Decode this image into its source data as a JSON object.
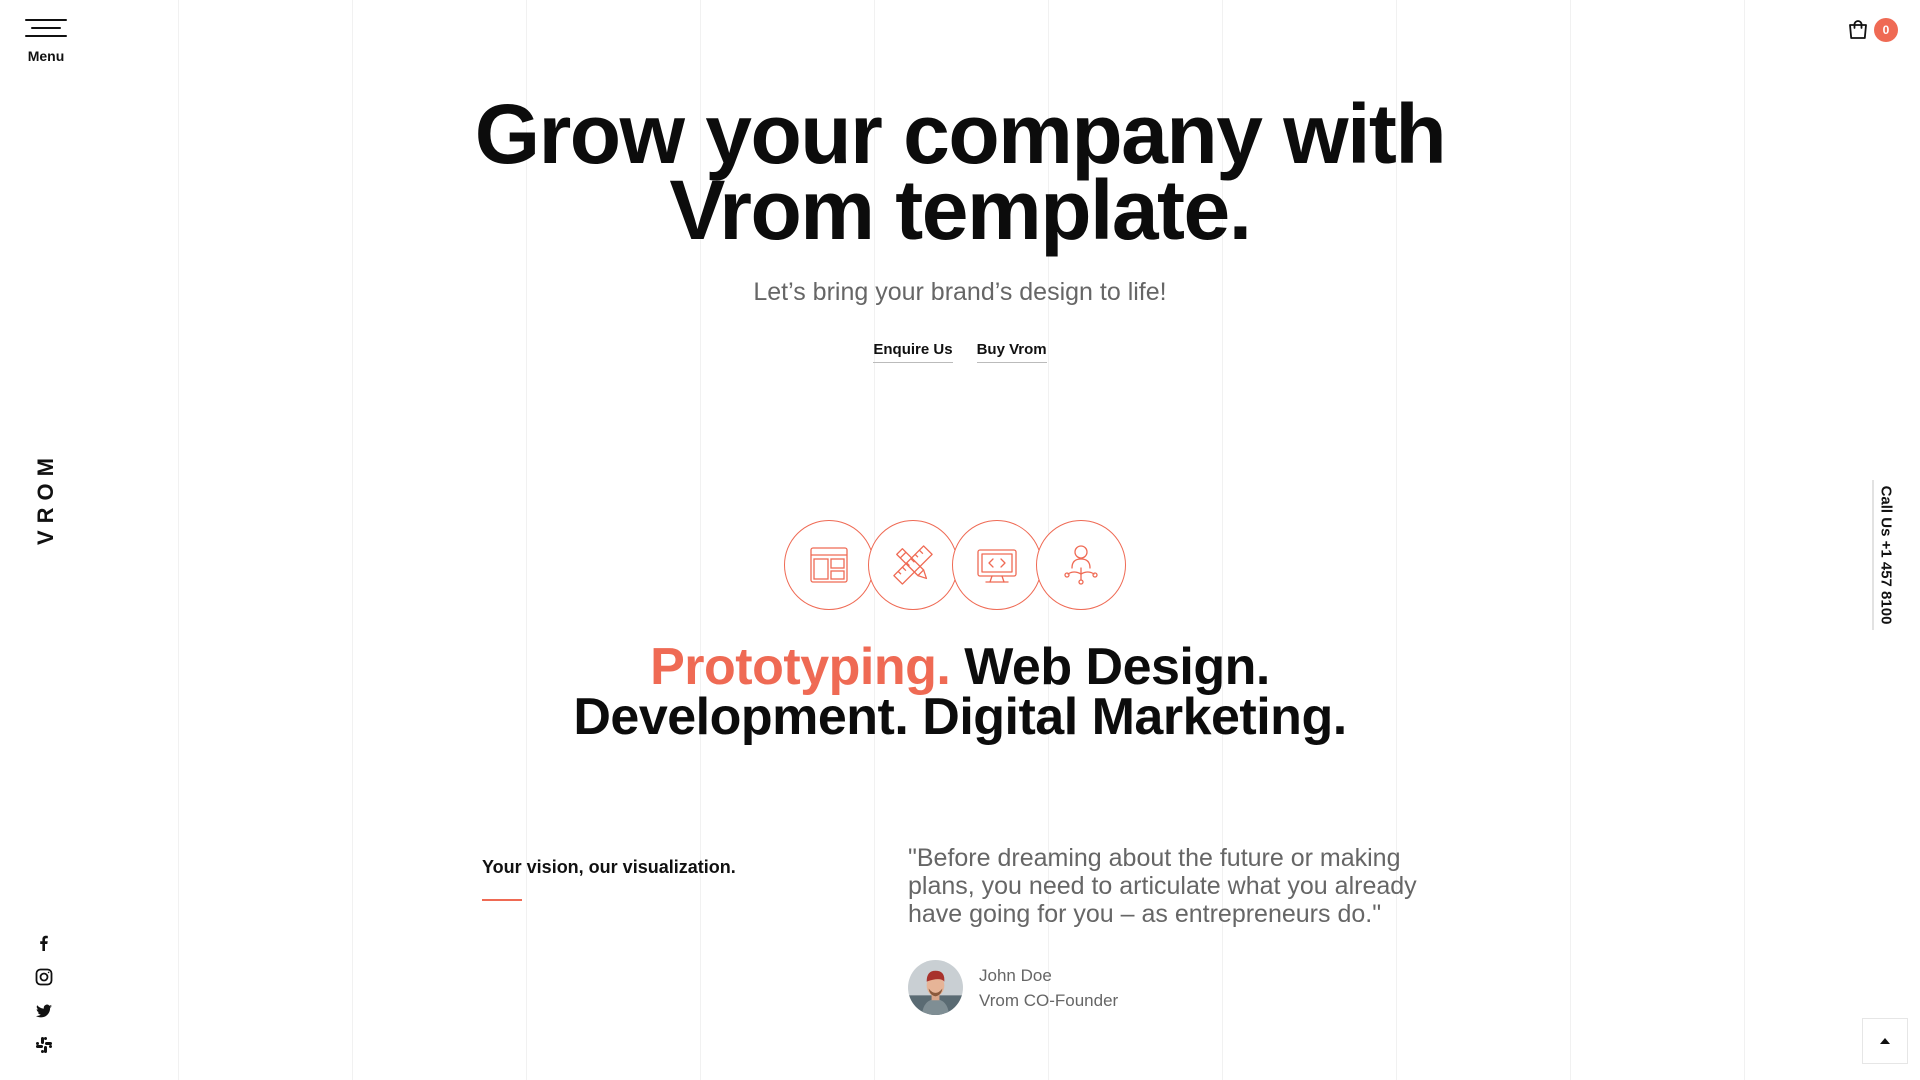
{
  "menu": {
    "label": "Menu",
    "icon": "hamburger-icon"
  },
  "brand": {
    "name": "VROM"
  },
  "cart": {
    "count": "0",
    "icon": "shopping-bag-icon",
    "badge_color": "#ef6a54"
  },
  "callus": {
    "text": "Call Us +1 457 8100"
  },
  "hero": {
    "title_line1": "Grow your company with",
    "title_line2": "Vrom template.",
    "subtitle": "Let’s bring your brand’s design to life!",
    "links": [
      "Enquire Us",
      "Buy Vrom"
    ]
  },
  "services": {
    "icons": [
      "layout-icon",
      "pencil-ruler-icon",
      "code-monitor-icon",
      "network-user-icon"
    ],
    "accent_color": "#ef6a54"
  },
  "tagline": {
    "accent": "Prototyping.",
    "rest_line1": "Web Design.",
    "line2": "Development. Digital Marketing."
  },
  "vision": {
    "heading": "Your vision, our visualization."
  },
  "testimonial": {
    "quote": "\"Before dreaming about the future or making plans, you need to articulate what you already have going for you – as entrepreneurs do.\"",
    "author_name": "John Doe",
    "author_role": "Vrom CO-Founder"
  },
  "socials": [
    "facebook-icon",
    "instagram-icon",
    "twitter-icon",
    "slack-icon"
  ],
  "to_top": {
    "icon": "arrow-up-icon"
  }
}
